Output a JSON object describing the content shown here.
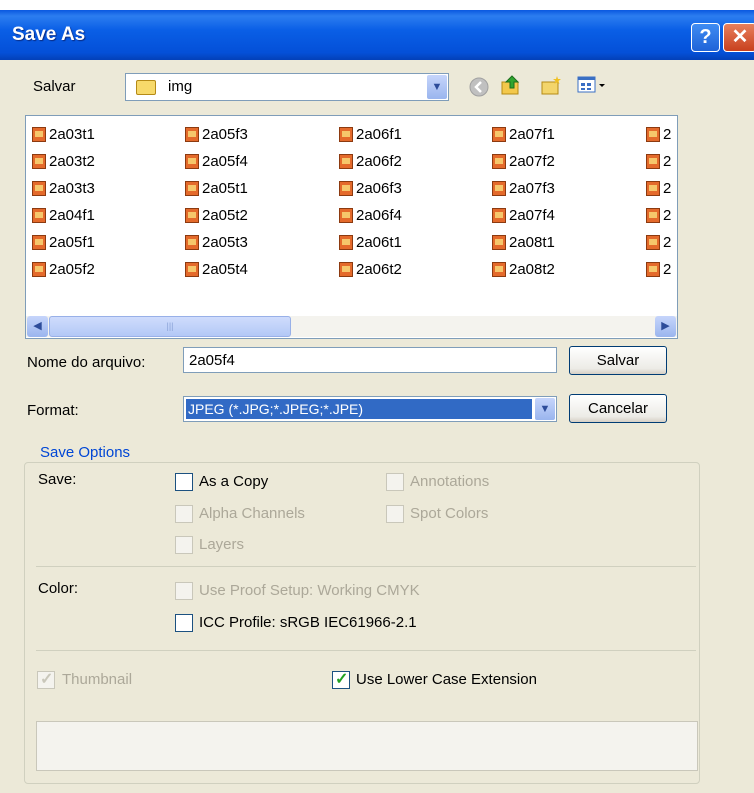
{
  "window": {
    "title": "Save As"
  },
  "title_buttons": {
    "help": "?",
    "close": "✕"
  },
  "top": {
    "save_in_label": "Salvar",
    "folder_name": "img"
  },
  "files": {
    "col1": [
      "2a03t1",
      "2a03t2",
      "2a03t3",
      "2a04f1",
      "2a05f1",
      "2a05f2"
    ],
    "col2": [
      "2a05f3",
      "2a05f4",
      "2a05t1",
      "2a05t2",
      "2a05t3",
      "2a05t4"
    ],
    "col3": [
      "2a06f1",
      "2a06f2",
      "2a06f3",
      "2a06f4",
      "2a06t1",
      "2a06t2"
    ],
    "col4": [
      "2a07f1",
      "2a07f2",
      "2a07f3",
      "2a07f4",
      "2a08t1",
      "2a08t2"
    ],
    "col5_partial": [
      "2",
      "2",
      "2",
      "2",
      "2",
      "2"
    ]
  },
  "filename": {
    "label": "Nome do arquivo:",
    "value": "2a05f4"
  },
  "format": {
    "label": "Format:",
    "value": "JPEG (*.JPG;*.JPEG;*.JPE)"
  },
  "buttons": {
    "save": "Salvar",
    "cancel": "Cancelar"
  },
  "options": {
    "group_title": "Save Options",
    "save_label": "Save:",
    "as_a_copy": "As a Copy",
    "annotations": "Annotations",
    "alpha_channels": "Alpha Channels",
    "spot_colors": "Spot Colors",
    "layers": "Layers",
    "color_label": "Color:",
    "use_proof_setup": "Use Proof Setup:  Working CMYK",
    "icc_profile": "ICC Profile:  sRGB IEC61966-2.1",
    "thumbnail": "Thumbnail",
    "lower_case_ext": "Use Lower Case Extension"
  },
  "colors": {
    "title_bar": "#0a58e0",
    "dialog_bg": "#ece9d8",
    "selection": "#316ac5",
    "group_title": "#0046d5"
  },
  "icons": [
    "folder-icon",
    "back-icon",
    "up-folder-icon",
    "new-folder-icon",
    "view-menu-icon",
    "image-file-icon"
  ]
}
